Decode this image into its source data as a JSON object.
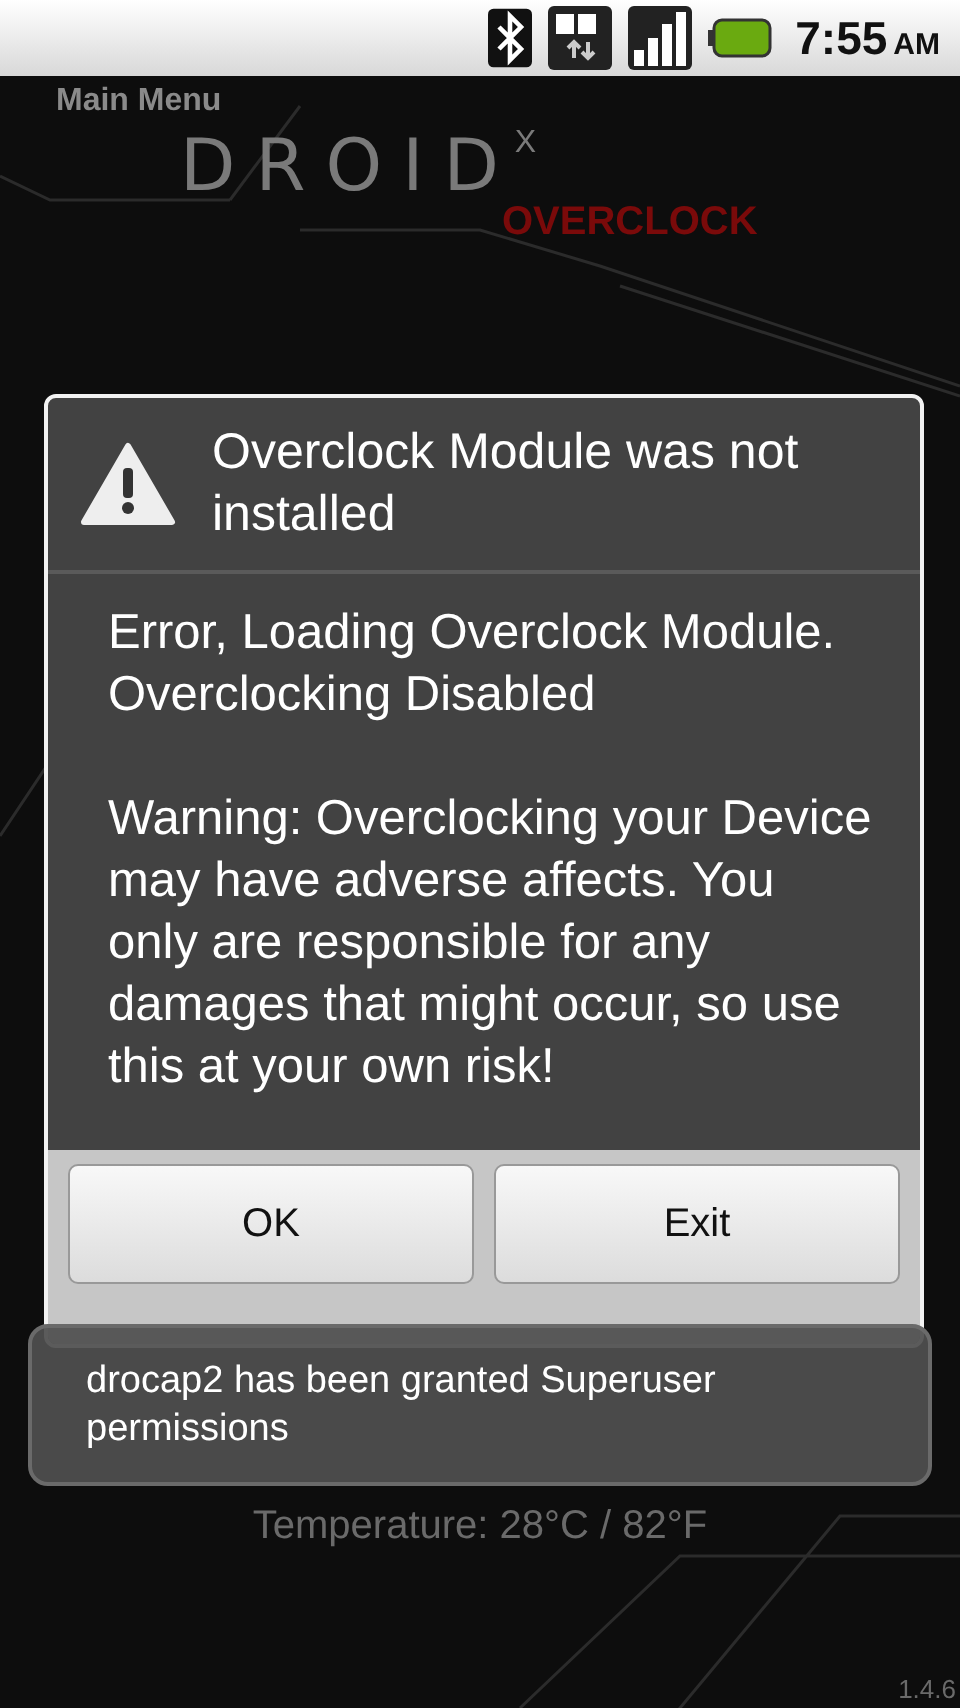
{
  "status_bar": {
    "time": "7:55",
    "ampm": "AM"
  },
  "header": {
    "title": "Main Menu",
    "logo": "DROID",
    "logo_mark": "X",
    "subtitle": "OVERCLOCK"
  },
  "footer": {
    "temperature": "Temperature: 28°C / 82°F",
    "version": "1.4.6"
  },
  "dialog": {
    "title": "Overclock Module was not installed",
    "message": "Error, Loading Overclock Module. Overclocking Disabled",
    "warning": "Warning: Overclocking your Device may have adverse affects. You only are responsible for any damages that might occur, so use this at your own risk!",
    "buttons": [
      "OK",
      "Exit"
    ]
  },
  "toast": {
    "text": "drocap2 has been granted Superuser permissions"
  }
}
